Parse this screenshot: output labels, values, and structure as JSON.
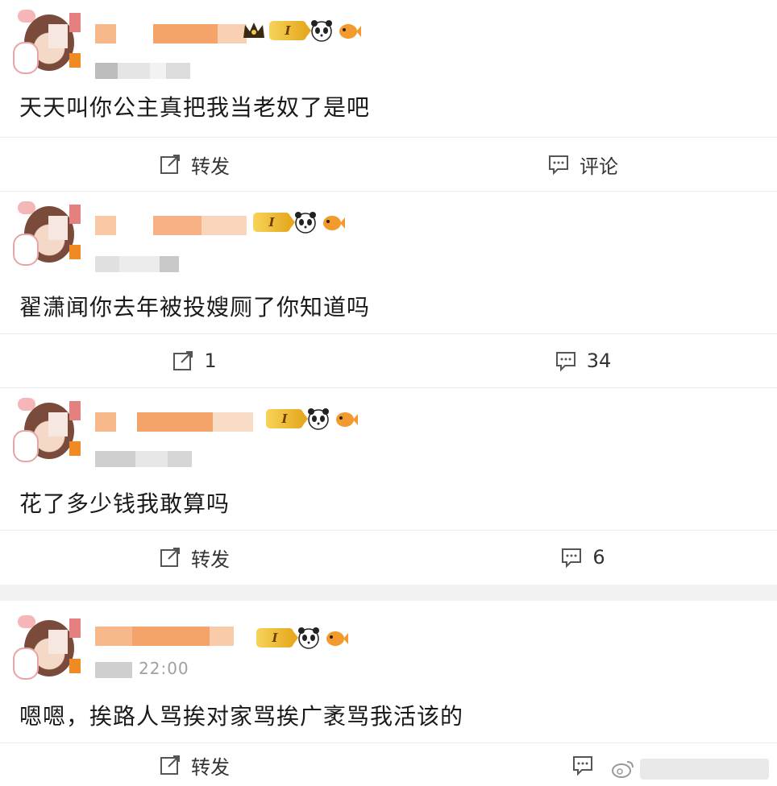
{
  "posts": [
    {
      "content": "天天叫你公主真把我当老奴了是吧",
      "repost_label": "转发",
      "comment_label": "评论",
      "level_badge": "I"
    },
    {
      "content": "翟潇闻你去年被投嫂厕了你知道吗",
      "repost_label": "1",
      "comment_label": "34",
      "level_badge": "I"
    },
    {
      "content": "花了多少钱我敢算吗",
      "repost_label": "转发",
      "comment_label": "6",
      "level_badge": "I"
    },
    {
      "content": "嗯嗯，挨路人骂挨对家骂挨广袤骂我活该的",
      "time": "22:00",
      "repost_label": "转发",
      "level_badge": "I"
    }
  ],
  "colors": {
    "accent_orange": "#f08a24",
    "level_gold": "#e6a91f",
    "divider": "#ececec"
  },
  "icons": [
    "repost-icon",
    "comment-icon",
    "crown-icon",
    "panda-icon",
    "fish-icon"
  ]
}
